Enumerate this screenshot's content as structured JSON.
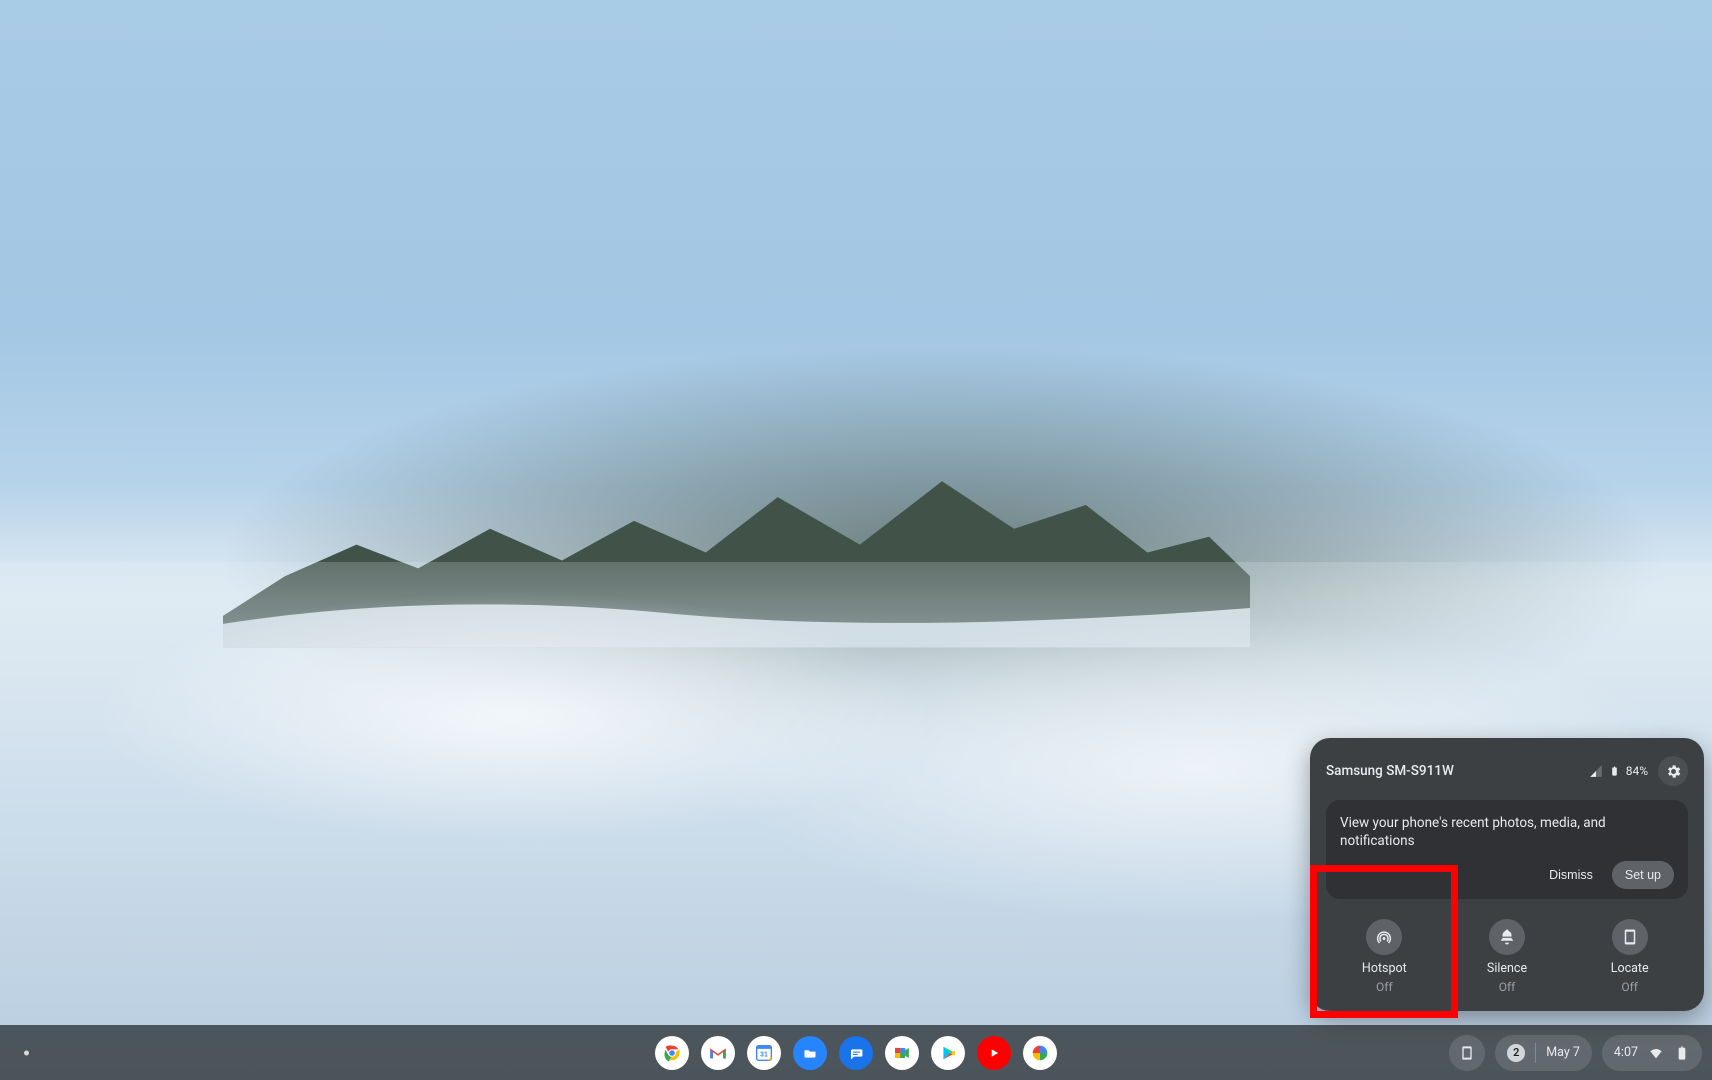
{
  "phone_hub": {
    "device_name": "Samsung SM-S911W",
    "battery_pct": "84%",
    "card": {
      "message": "View your phone's recent photos, media, and notifications",
      "dismiss_label": "Dismiss",
      "setup_label": "Set up"
    },
    "toggles": [
      {
        "label": "Hotspot",
        "status": "Off",
        "icon": "hotspot-icon"
      },
      {
        "label": "Silence",
        "status": "Off",
        "icon": "silence-icon"
      },
      {
        "label": "Locate",
        "status": "Off",
        "icon": "locate-icon"
      }
    ],
    "highlighted_toggle_index": 0
  },
  "shelf": {
    "apps": [
      {
        "name": "Chrome",
        "icon": "chrome-icon"
      },
      {
        "name": "Gmail",
        "icon": "gmail-icon"
      },
      {
        "name": "Calendar",
        "icon": "calendar-icon",
        "day": "31"
      },
      {
        "name": "Files",
        "icon": "files-icon"
      },
      {
        "name": "Messages",
        "icon": "messages-icon"
      },
      {
        "name": "Meet",
        "icon": "meet-icon"
      },
      {
        "name": "Play Store",
        "icon": "play-icon"
      },
      {
        "name": "YouTube",
        "icon": "youtube-icon"
      },
      {
        "name": "Photos",
        "icon": "photos-icon"
      }
    ],
    "notification_count": "2",
    "date_label": "May 7",
    "time_label": "4:07"
  }
}
